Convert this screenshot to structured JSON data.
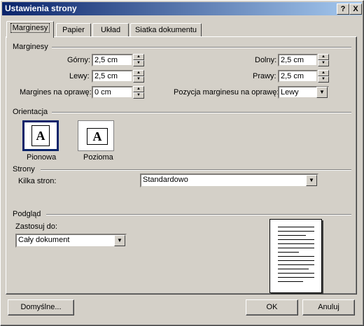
{
  "window": {
    "title": "Ustawienia strony",
    "help_btn": "?",
    "close_btn": "X"
  },
  "tabs": [
    {
      "label": "Marginesy"
    },
    {
      "label": "Papier"
    },
    {
      "label": "Układ"
    },
    {
      "label": "Siatka dokumentu"
    }
  ],
  "margins": {
    "group_label": "Marginesy",
    "top_label": "Górny:",
    "top_value": "2,5 cm",
    "bottom_label": "Dolny:",
    "bottom_value": "2,5 cm",
    "left_label": "Lewy:",
    "left_value": "2,5 cm",
    "right_label": "Prawy:",
    "right_value": "2,5 cm",
    "gutter_label": "Margines na oprawę:",
    "gutter_value": "0 cm",
    "gutter_pos_label": "Pozycja marginesu na oprawę:",
    "gutter_pos_value": "Lewy"
  },
  "orientation": {
    "group_label": "Orientacja",
    "portrait_label": "Pionowa",
    "landscape_label": "Pozioma",
    "icon_letter": "A",
    "selected": "portrait"
  },
  "pages": {
    "group_label": "Strony",
    "multiple_label": "Kilka stron:",
    "multiple_value": "Standardowo"
  },
  "preview": {
    "group_label": "Podgląd",
    "apply_label": "Zastosuj do:",
    "apply_value": "Cały dokument"
  },
  "footer": {
    "default_btn": "Domyślne...",
    "ok_btn": "OK",
    "cancel_btn": "Anuluj"
  }
}
